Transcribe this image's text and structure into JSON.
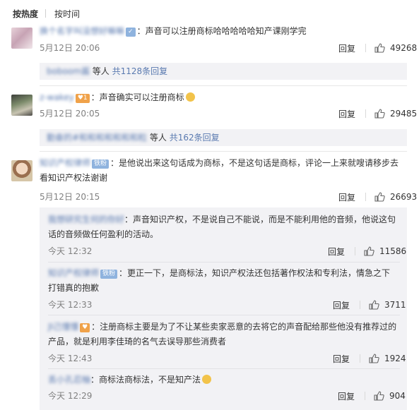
{
  "tabs": {
    "hot": "按热度",
    "time": "按时间"
  },
  "comments": [
    {
      "user": "换个名字叫没想好嘛嘛",
      "text": "：声音可以注册商标哈哈哈哈哈知产课刚学完",
      "time": "5月12日 20:06",
      "reply_label": "回复",
      "likes": "49268",
      "summary": {
        "users": "boboom酱",
        "mid": " 等人 ",
        "count": "共1128条回复"
      }
    },
    {
      "user": "z-wakey",
      "text": "：声音确实可以注册商标",
      "time": "5月12日 20:05",
      "reply_label": "回复",
      "likes": "29485",
      "summary": {
        "users": "勤奋的#和和和和和和和粒",
        "mid": " 等人 ",
        "count": "共162条回复"
      }
    },
    {
      "user": "知识产权律师",
      "badge": "铁粉",
      "text": "：是他说出来这句话成为商标，不是这句话是商标，评论一上来就嗖请移步去",
      "text2": "看知识产权法谢谢",
      "time": "5月12日 20:15",
      "reply_label": "回复",
      "likes": "26693",
      "replies": [
        {
          "user": "我想研究生何的你好",
          "text": "：声音知识产权，不是说自己不能说，而是不能利用他的音频，他说这句",
          "text2": "话的音频做任何盈利的活动。",
          "time": "今天 12:32",
          "reply_label": "回复",
          "likes": "11586"
        },
        {
          "user": "知识产权律师",
          "badge": "铁粉",
          "text": "：更正一下，是商标法，知识产权法还包括著作权法和专利法，情急之下",
          "text2": "打错真的抱歉",
          "time": "今天 12:33",
          "reply_label": "回复",
          "likes": "3711"
        },
        {
          "user": "JI己懂懂",
          "text": "：注册商标主要是为了不让某些卖家恶意的去将它的声音配给那些他没有推荐过的",
          "text2": "产品，就是利用李佳琦的名气去误导那些消费者",
          "time": "今天 12:43",
          "reply_label": "回复",
          "likes": "1924"
        },
        {
          "user": "丢小孔忍柚",
          "text": "：商标法商标法，不是知产法",
          "time": "今天 12:29",
          "reply_label": "回复",
          "likes": "904"
        }
      ]
    }
  ],
  "colors": {
    "link": "#5a7ab0",
    "reply_bg": "#f2f2f5",
    "badge": "#8fb3de"
  }
}
